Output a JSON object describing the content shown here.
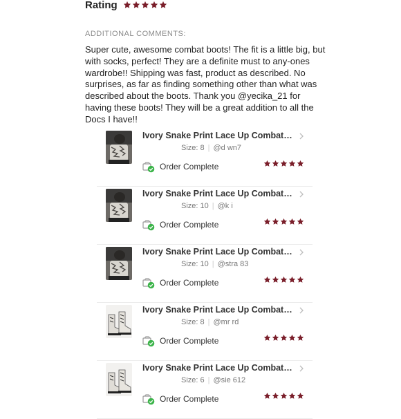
{
  "rating": {
    "label": "Rating",
    "stars": 5,
    "star_color": "#7a1e2a"
  },
  "comments": {
    "heading": "ADDITIONAL COMMENTS:",
    "text": "Super cute, awesome combat boots! The fit is a little big, but with socks, perfect! They are a definite must to any-ones wardrobe!! Shipping was fast, product as described. No surprises, as far as finding something other than what was described about the boots. Thank you @yecika_21 for having these boots! They will be a great addition to all the Docs I have!!"
  },
  "orders": [
    {
      "title": "Ivory Snake Print Lace Up Combat B...",
      "size": "Size: 8",
      "user": "@d          wn7",
      "status": "Order Complete",
      "stars": 5,
      "thumb": "worn-boots-photo"
    },
    {
      "title": "Ivory Snake Print Lace Up Combat B...",
      "size": "Size: 10",
      "user": "@k          i",
      "status": "Order Complete",
      "stars": 5,
      "thumb": "worn-boots-photo"
    },
    {
      "title": "Ivory Snake Print Lace Up Combat B...",
      "size": "Size: 10",
      "user": "@stra      83",
      "status": "Order Complete",
      "stars": 5,
      "thumb": "worn-boots-photo"
    },
    {
      "title": "Ivory Snake Print Lace Up Combat B...",
      "size": "Size: 8",
      "user": "@mr        rd",
      "status": "Order Complete",
      "stars": 5,
      "thumb": "boots-pair-photo"
    },
    {
      "title": "Ivory Snake Print Lace Up Combat B...",
      "size": "Size: 6",
      "user": "@sie       612",
      "status": "Order Complete",
      "stars": 5,
      "thumb": "boots-pair-photo"
    }
  ],
  "colors": {
    "star": "#7a1e2a",
    "check": "#3cb44a",
    "divider": "#ececec"
  }
}
